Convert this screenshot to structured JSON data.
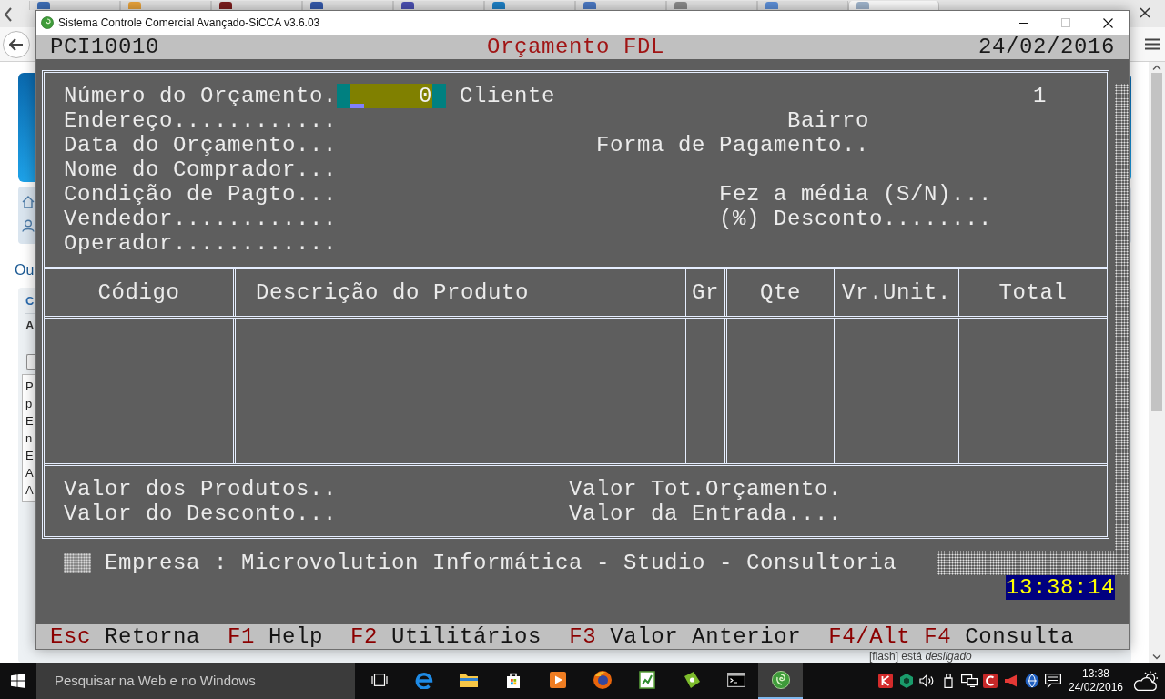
{
  "browser": {
    "tabs": [
      {
        "selected": false
      },
      {
        "selected": false
      },
      {
        "selected": false
      },
      {
        "selected": false
      },
      {
        "selected": false
      },
      {
        "selected": false
      },
      {
        "selected": false
      },
      {
        "selected": false
      },
      {
        "selected": false
      },
      {
        "selected": true
      }
    ],
    "heading": "Ou",
    "side_panel": {
      "title": "C",
      "subtitle": "A",
      "items": [
        "P",
        "p",
        "E",
        "n",
        "E",
        "A",
        "A"
      ]
    },
    "status_lines": [
      "[flash] está *desligado*"
    ]
  },
  "window": {
    "title": "Sistema Controle Comercial Avançado-SiCCA v3.6.03",
    "maximize_disabled": true
  },
  "console": {
    "header": {
      "program_code": "PCI10010",
      "title": "Orçamento FDL",
      "date": "24/02/2016"
    },
    "form_rows": [
      {
        "left": {
          "label": "Número do Orçamento.",
          "value": "0",
          "focused": true
        },
        "right": {
          "label": "Cliente",
          "value": "1"
        }
      },
      {
        "left": {
          "label": "Endereço............"
        },
        "right": {
          "label": "Bairro"
        }
      },
      {
        "left": {
          "label": "Data do Orçamento..."
        },
        "right": {
          "label": "Forma de Pagamento.."
        }
      },
      {
        "left": {
          "label": "Nome do Comprador..."
        }
      },
      {
        "left": {
          "label": "Condição de Pagto..."
        },
        "right": {
          "label": "Fez a média (S/N)..."
        }
      },
      {
        "left": {
          "label": "Vendedor............"
        },
        "right": {
          "label": "(%) Desconto........"
        }
      },
      {
        "left": {
          "label": "Operador............"
        }
      }
    ],
    "table": {
      "columns": [
        "Código",
        "Descrição do Produto",
        "Gr",
        "Qte",
        "Vr.Unit.",
        "Total"
      ]
    },
    "totals_rows": [
      {
        "left": {
          "label": "Valor dos Produtos.."
        },
        "right": {
          "label": "Valor Tot.Orçamento."
        }
      },
      {
        "left": {
          "label": "Valor do Desconto..."
        },
        "right": {
          "label": "Valor da Entrada...."
        }
      }
    ],
    "company_line": "Empresa : Microvolution Informática - Studio - Consultoria",
    "clock": "13:38:14",
    "function_keys": [
      {
        "key": "Esc",
        "action": "Retorna"
      },
      {
        "key": "F1",
        "action": "Help"
      },
      {
        "key": "F2",
        "action": "Utilitários"
      },
      {
        "key": "F3",
        "action": "Valor Anterior"
      },
      {
        "key": "F4/Alt F4",
        "action": "Consulta"
      }
    ]
  },
  "taskbar": {
    "search": {
      "placeholder": "Pesquisar na Web e no Windows"
    },
    "apps": [
      {
        "selected": false
      },
      {
        "selected": false
      },
      {
        "selected": false
      },
      {
        "selected": false
      },
      {
        "selected": false
      },
      {
        "selected": false
      },
      {
        "selected": false
      },
      {
        "selected": false
      },
      {
        "selected": true
      }
    ],
    "clock": {
      "time": "13:38",
      "date": "24/02/2016"
    }
  }
}
